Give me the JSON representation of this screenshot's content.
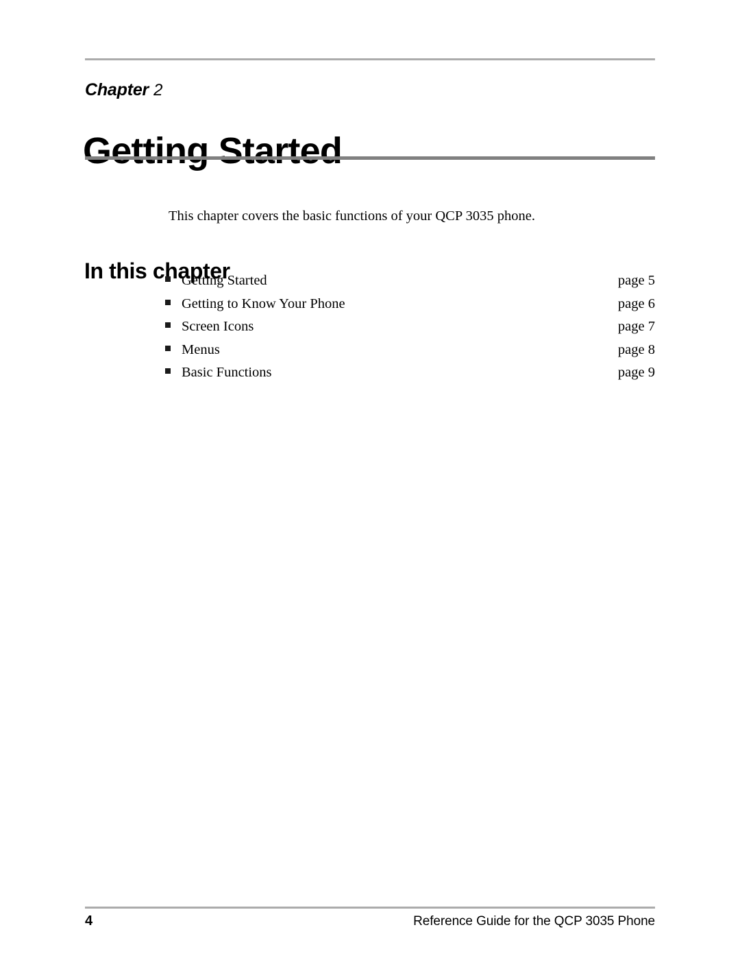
{
  "document": {
    "page_number": "4",
    "footer_text": "Reference Guide for the QCP 3035 Phone"
  },
  "header": {
    "chapter_word": "Chapter",
    "chapter_number": "2",
    "title": "Getting Started"
  },
  "intro": {
    "paragraph": "This chapter covers the basic functions of your QCP 3035 phone."
  },
  "section": {
    "heading": "In this chapter",
    "items": [
      {
        "label": "Getting Started",
        "page": "page 5"
      },
      {
        "label": "Getting to Know Your Phone",
        "page": "page 6"
      },
      {
        "label": "Screen Icons",
        "page": "page 7"
      },
      {
        "label": "Menus",
        "page": "page 8"
      },
      {
        "label": "Basic Functions",
        "page": "page 9"
      }
    ]
  },
  "colors": {
    "rule_light": "#ababab",
    "rule_dark": "#808080",
    "text": "#000000",
    "background": "#ffffff"
  }
}
